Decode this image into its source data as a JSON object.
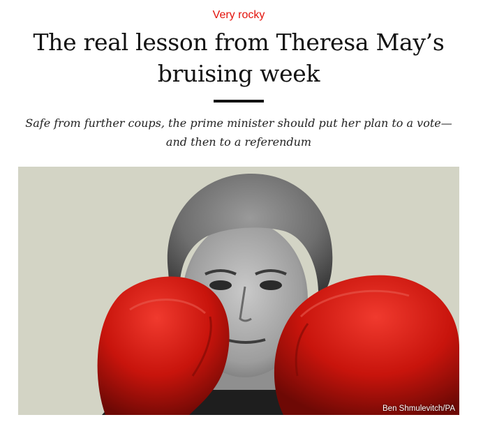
{
  "article": {
    "kicker": "Very rocky",
    "headline": "The real lesson from Theresa May’s bruising week",
    "standfirst": "Safe from further coups, the prime minister should put her plan to a vote—and then to a referendum",
    "image": {
      "credit": "Ben Shmulevitch/PA",
      "background_color": "#d3d4c5",
      "glove_color": "#c8140c"
    }
  },
  "colors": {
    "kicker": "#e3120b",
    "headline": "#121212",
    "rule": "#121212"
  }
}
